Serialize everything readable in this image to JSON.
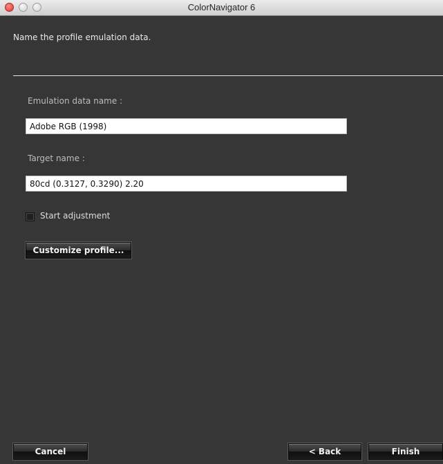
{
  "window": {
    "title": "ColorNavigator 6"
  },
  "instruction": "Name the profile emulation data.",
  "form": {
    "emulation_label": "Emulation data name :",
    "emulation_value": "Adobe RGB (1998)",
    "target_label": "Target name :",
    "target_value": "80cd (0.3127, 0.3290) 2.20",
    "checkbox_label": "Start adjustment",
    "checkbox_checked": false,
    "customize_label": "Customize profile..."
  },
  "footer": {
    "cancel_label": "Cancel",
    "back_label": "< Back",
    "finish_label": "Finish"
  }
}
